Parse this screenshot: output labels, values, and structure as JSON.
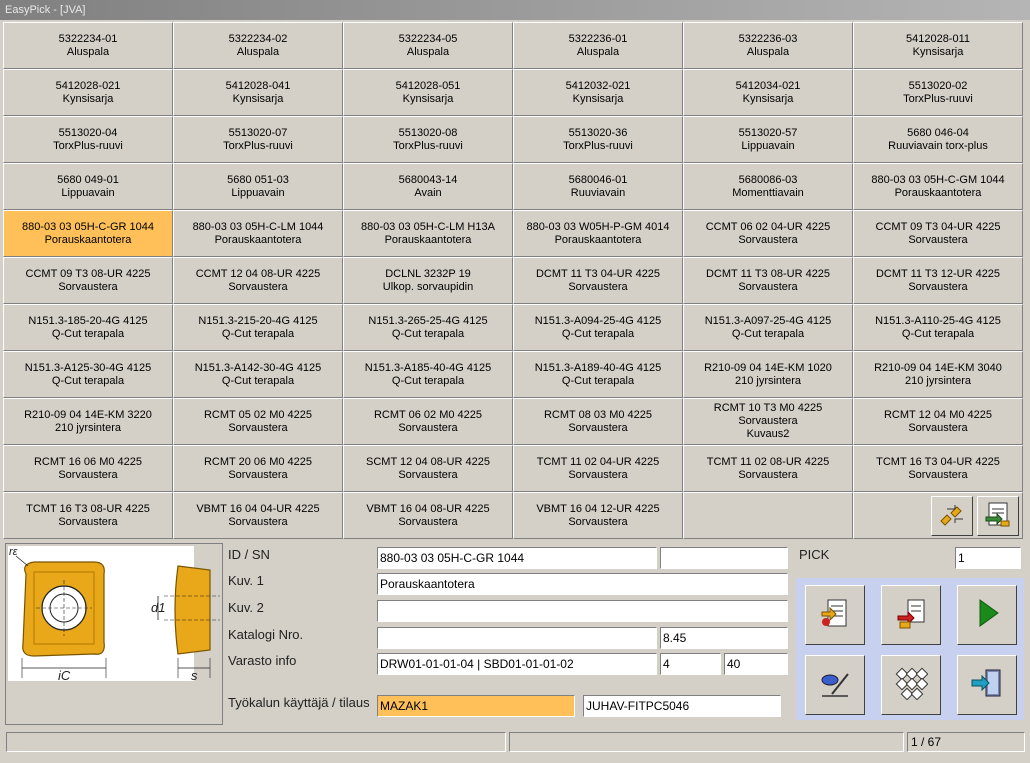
{
  "window": {
    "title": "EasyPick - [JVA]"
  },
  "grid": {
    "items": [
      {
        "code": "5322234-01",
        "desc": "Aluspala"
      },
      {
        "code": "5322234-02",
        "desc": "Aluspala"
      },
      {
        "code": "5322234-05",
        "desc": "Aluspala"
      },
      {
        "code": "5322236-01",
        "desc": "Aluspala"
      },
      {
        "code": "5322236-03",
        "desc": "Aluspala"
      },
      {
        "code": "5412028-011",
        "desc": "Kynsisarja"
      },
      {
        "code": "5412028-021",
        "desc": "Kynsisarja"
      },
      {
        "code": "5412028-041",
        "desc": "Kynsisarja"
      },
      {
        "code": "5412028-051",
        "desc": "Kynsisarja"
      },
      {
        "code": "5412032-021",
        "desc": "Kynsisarja"
      },
      {
        "code": "5412034-021",
        "desc": "Kynsisarja"
      },
      {
        "code": "5513020-02",
        "desc": "TorxPlus-ruuvi"
      },
      {
        "code": "5513020-04",
        "desc": "TorxPlus-ruuvi"
      },
      {
        "code": "5513020-07",
        "desc": "TorxPlus-ruuvi"
      },
      {
        "code": "5513020-08",
        "desc": "TorxPlus-ruuvi"
      },
      {
        "code": "5513020-36",
        "desc": "TorxPlus-ruuvi"
      },
      {
        "code": "5513020-57",
        "desc": "Lippuavain"
      },
      {
        "code": "5680 046-04",
        "desc": "Ruuviavain torx-plus"
      },
      {
        "code": "5680 049-01",
        "desc": "Lippuavain"
      },
      {
        "code": "5680 051-03",
        "desc": "Lippuavain"
      },
      {
        "code": "5680043-14",
        "desc": "Avain"
      },
      {
        "code": "5680046-01",
        "desc": "Ruuviavain"
      },
      {
        "code": "5680086-03",
        "desc": "Momenttiavain"
      },
      {
        "code": "880-03 03 05H-C-GM  1044",
        "desc": "Porauskaantotera"
      },
      {
        "code": "880-03 03 05H-C-GR  1044",
        "desc": "Porauskaantotera",
        "selected": true
      },
      {
        "code": "880-03 03 05H-C-LM  1044",
        "desc": "Porauskaantotera"
      },
      {
        "code": "880-03 03 05H-C-LM  H13A",
        "desc": "Porauskaantotera"
      },
      {
        "code": "880-03 03 W05H-P-GM  4014",
        "desc": "Porauskaantotera"
      },
      {
        "code": "CCMT 06 02 04-UR 4225",
        "desc": "Sorvaustera"
      },
      {
        "code": "CCMT 09 T3 04-UR 4225",
        "desc": "Sorvaustera"
      },
      {
        "code": "CCMT 09 T3 08-UR 4225",
        "desc": "Sorvaustera"
      },
      {
        "code": "CCMT 12 04 08-UR 4225",
        "desc": "Sorvaustera"
      },
      {
        "code": "DCLNL 3232P 19",
        "desc": "Ulkop. sorvaupidin"
      },
      {
        "code": "DCMT 11 T3 04-UR  4225",
        "desc": "Sorvaustera"
      },
      {
        "code": "DCMT 11 T3 08-UR 4225",
        "desc": "Sorvaustera"
      },
      {
        "code": "DCMT 11 T3 12-UR 4225",
        "desc": "Sorvaustera"
      },
      {
        "code": "N151.3-185-20-4G 4125",
        "desc": "Q-Cut terapala"
      },
      {
        "code": "N151.3-215-20-4G 4125",
        "desc": "Q-Cut terapala"
      },
      {
        "code": "N151.3-265-25-4G 4125",
        "desc": "Q-Cut terapala"
      },
      {
        "code": "N151.3-A094-25-4G 4125",
        "desc": "Q-Cut terapala"
      },
      {
        "code": "N151.3-A097-25-4G 4125",
        "desc": "Q-Cut terapala"
      },
      {
        "code": "N151.3-A110-25-4G 4125",
        "desc": "Q-Cut terapala"
      },
      {
        "code": "N151.3-A125-30-4G 4125",
        "desc": "Q-Cut terapala"
      },
      {
        "code": "N151.3-A142-30-4G 4125",
        "desc": "Q-Cut terapala"
      },
      {
        "code": "N151.3-A185-40-4G  4125",
        "desc": "Q-Cut terapala"
      },
      {
        "code": "N151.3-A189-40-4G 4125",
        "desc": "Q-Cut terapala"
      },
      {
        "code": "R210-09 04 14E-KM 1020",
        "desc": "210 jyrsintera"
      },
      {
        "code": "R210-09 04 14E-KM 3040",
        "desc": "210 jyrsintera"
      },
      {
        "code": "R210-09 04 14E-KM 3220",
        "desc": "210 jyrsintera"
      },
      {
        "code": "RCMT 05 02 M0 4225",
        "desc": "Sorvaustera"
      },
      {
        "code": "RCMT 06 02 M0 4225",
        "desc": "Sorvaustera"
      },
      {
        "code": "RCMT 08 03 M0 4225",
        "desc": "Sorvaustera"
      },
      {
        "code": "RCMT 10 T3 M0 4225",
        "desc": "Sorvaustera",
        "desc2": "Kuvaus2"
      },
      {
        "code": "RCMT 12 04 M0 4225",
        "desc": "Sorvaustera"
      },
      {
        "code": "RCMT 16 06 M0 4225",
        "desc": "Sorvaustera"
      },
      {
        "code": "RCMT 20 06 M0 4225",
        "desc": "Sorvaustera"
      },
      {
        "code": "SCMT 12 04 08-UR 4225",
        "desc": "Sorvaustera"
      },
      {
        "code": "TCMT 11 02 04-UR 4225",
        "desc": "Sorvaustera"
      },
      {
        "code": "TCMT 11 02 08-UR 4225",
        "desc": "Sorvaustera"
      },
      {
        "code": "TCMT 16 T3 04-UR 4225",
        "desc": "Sorvaustera"
      },
      {
        "code": "TCMT 16 T3 08-UR 4225",
        "desc": "Sorvaustera"
      },
      {
        "code": "VBMT 16 04 04-UR 4225",
        "desc": "Sorvaustera"
      },
      {
        "code": "VBMT 16 04 08-UR 4225",
        "desc": "Sorvaustera"
      },
      {
        "code": "VBMT 16 04 12-UR 4225",
        "desc": "Sorvaustera"
      }
    ]
  },
  "toolbar_icons": [
    "transfer-icon",
    "report-icon"
  ],
  "details": {
    "labels": {
      "id_sn": "ID / SN",
      "kuv1": "Kuv. 1",
      "kuv2": "Kuv. 2",
      "katalogi": "Katalogi Nro.",
      "varasto": "Varasto info",
      "user": "Työkalun käyttäjä / tilaus",
      "pick": "PICK"
    },
    "values": {
      "id_sn": "880-03 03 05H-C-GR  1044",
      "sn": "",
      "kuv1": "Porauskaantotera",
      "kuv2": "",
      "katalogi": "",
      "price": "8.45",
      "varasto": "DRW01-01-01-04 | SBD01-01-01-02",
      "qty": "4",
      "max": "40",
      "user": "MAZAK1",
      "order": "JUHAV-FITPC5046",
      "pick": "1"
    },
    "picture_labels": {
      "rc": "rε",
      "d1": "d1",
      "ic": "iC",
      "s": "s"
    }
  },
  "actions": [
    "list-icon",
    "export-icon",
    "play-icon",
    "edit-icon",
    "pattern-icon",
    "exit-icon"
  ],
  "status": {
    "page": "1 / 67"
  },
  "colors": {
    "selected": "#ffc05a",
    "action_panel": "#c8d0f0",
    "play": "#1a8a1a"
  }
}
